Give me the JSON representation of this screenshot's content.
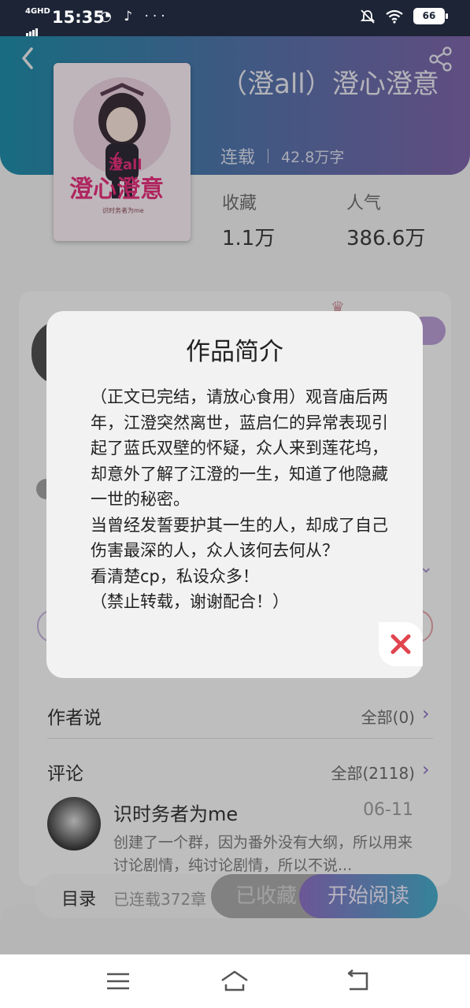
{
  "status_bar": {
    "network": "4GHD",
    "time": "15:35",
    "app_icons": "◔ ♪ ···",
    "battery": "66"
  },
  "book": {
    "title": "（澄all）澄心澄意",
    "status": "连载",
    "word_count": "42.8万字",
    "stats": [
      {
        "label": "收藏",
        "value": "1.1万"
      },
      {
        "label": "人气",
        "value": "386.6万"
      }
    ],
    "cover": {
      "title_top": "澄all",
      "title_main": "澄心澄意",
      "author_line": "识时务者为me"
    }
  },
  "modal": {
    "title": "作品简介",
    "body": "（正文已完结，请放心食用）观音庙后两年，江澄突然离世，蓝启仁的异常表现引起了蓝氏双壁的怀疑，众人来到莲花坞，却意外了解了江澄的一生，知道了他隐藏一世的秘密。\n当曾经发誓要护其一生的人，却成了自己伤害最深的人，众人该何去何从？\n看清楚cp，私设众多！\n（禁止转载，谢谢配合！）",
    "close_icon": "close-icon"
  },
  "author_says": {
    "title": "作者说",
    "link": "全部(0)"
  },
  "comments": {
    "title": "评论",
    "link": "全部(2118)",
    "items": [
      {
        "name": "识时务者为me",
        "date": "06-11",
        "text": "创建了一个群，因为番外没有大纲，所以用来讨论剧情，纯讨论剧情，所以不说..."
      }
    ]
  },
  "action_bar": {
    "toc_label": "目录",
    "toc_count": "已连载372章",
    "collected_label": "已收藏",
    "read_label": "开始阅读"
  },
  "colors": {
    "header_start": "#1f8aa6",
    "header_end": "#7c63a6",
    "close_red": "#e0454f",
    "accent_purple": "#8b6fc1"
  }
}
